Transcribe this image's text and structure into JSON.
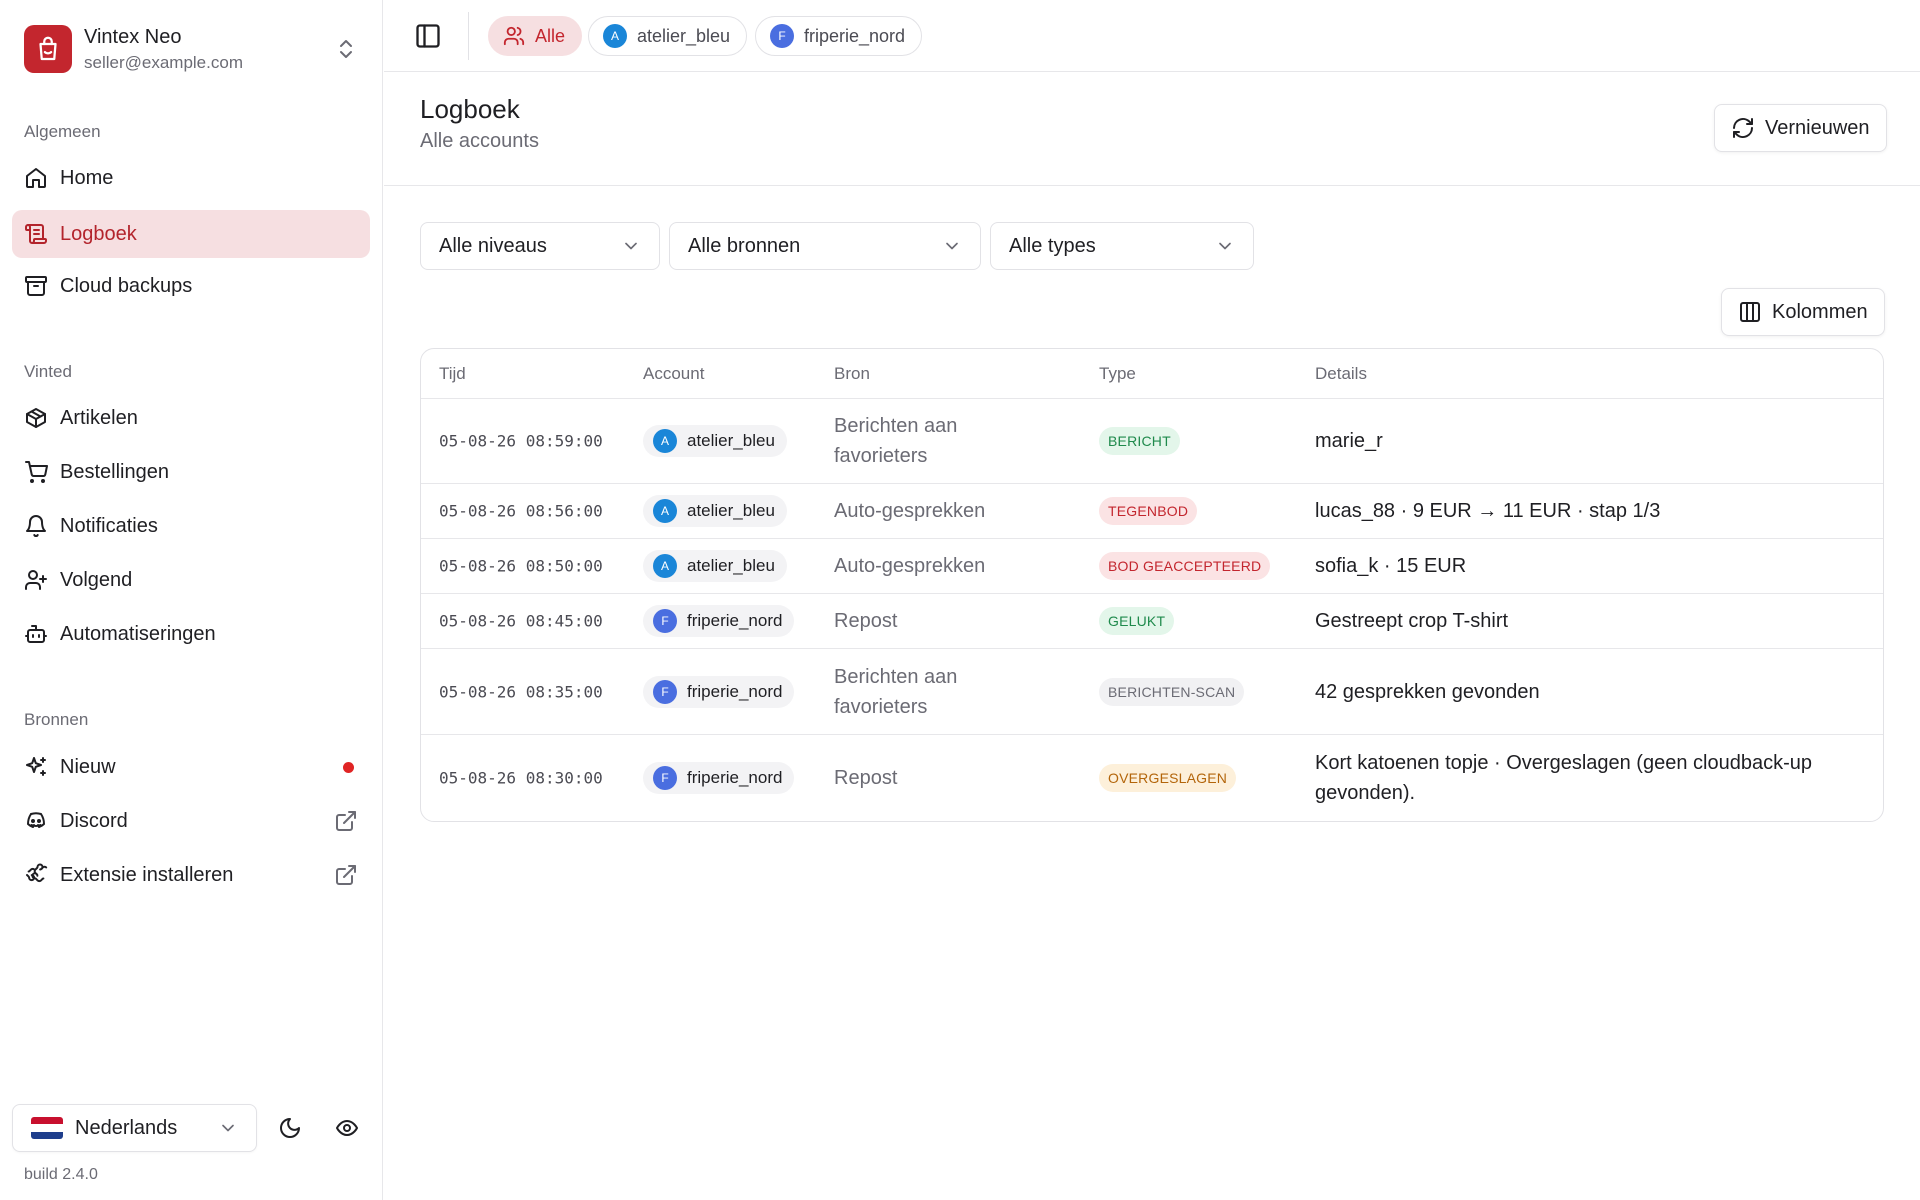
{
  "app": {
    "name": "Vintex Neo",
    "email": "seller@example.com",
    "brand_color": "#c3262e"
  },
  "sidebar": {
    "sections": {
      "general": "Algemeen",
      "vinted": "Vinted",
      "sources": "Bronnen"
    },
    "general_items": [
      {
        "label": "Home",
        "icon": "home-icon"
      },
      {
        "label": "Logboek",
        "icon": "logbook-icon",
        "active": true
      },
      {
        "label": "Cloud backups",
        "icon": "archive-icon"
      }
    ],
    "vinted_items": [
      {
        "label": "Artikelen",
        "icon": "package-icon"
      },
      {
        "label": "Bestellingen",
        "icon": "cart-icon"
      },
      {
        "label": "Notificaties",
        "icon": "bell-icon"
      },
      {
        "label": "Volgend",
        "icon": "user-plus-icon"
      },
      {
        "label": "Automatiseringen",
        "icon": "bot-icon"
      }
    ],
    "source_items": [
      {
        "label": "Nieuw",
        "icon": "sparkles-icon",
        "badge": "new-dot"
      },
      {
        "label": "Discord",
        "icon": "discord-icon",
        "trail": "external-link-icon"
      },
      {
        "label": "Extensie installeren",
        "icon": "puzzle-icon",
        "trail": "external-link-icon"
      }
    ],
    "language": "Nederlands",
    "build": "build 2.4.0"
  },
  "topbar": {
    "chips": [
      {
        "label": "Alle",
        "icon": "users-icon",
        "active": true
      },
      {
        "label": "atelier_bleu",
        "initial": "A",
        "color": "#1a86d8"
      },
      {
        "label": "friperie_nord",
        "initial": "F",
        "color": "#4a6ee0"
      }
    ]
  },
  "page": {
    "title": "Logboek",
    "subtitle": "Alle accounts",
    "refresh_label": "Vernieuwen",
    "columns_label": "Kolommen",
    "filters": {
      "levels": "Alle niveaus",
      "sources": "Alle bronnen",
      "types": "Alle types"
    }
  },
  "table": {
    "headers": {
      "time": "Tijd",
      "account": "Account",
      "source": "Bron",
      "type": "Type",
      "details": "Details"
    },
    "rows": [
      {
        "time": "05-08-26 08:59:00",
        "account": "atelier_bleu",
        "initial": "A",
        "avatar_color": "#1a86d8",
        "source": "Berichten aan favorieters",
        "type": "BERICHT",
        "type_style": "green",
        "details": "marie_r"
      },
      {
        "time": "05-08-26 08:56:00",
        "account": "atelier_bleu",
        "initial": "A",
        "avatar_color": "#1a86d8",
        "source": "Auto-gesprekken",
        "type": "TEGENBOD",
        "type_style": "red",
        "details": "lucas_88 · 9 EUR → 11 EUR · stap 1/3"
      },
      {
        "time": "05-08-26 08:50:00",
        "account": "atelier_bleu",
        "initial": "A",
        "avatar_color": "#1a86d8",
        "source": "Auto-gesprekken",
        "type": "BOD GEACCEPTEERD",
        "type_style": "red",
        "details": "sofia_k · 15 EUR"
      },
      {
        "time": "05-08-26 08:45:00",
        "account": "friperie_nord",
        "initial": "F",
        "avatar_color": "#4a6ee0",
        "source": "Repost",
        "type": "GELUKT",
        "type_style": "green",
        "details": "Gestreept crop T-shirt"
      },
      {
        "time": "05-08-26 08:35:00",
        "account": "friperie_nord",
        "initial": "F",
        "avatar_color": "#4a6ee0",
        "source": "Berichten aan favorieters",
        "type": "BERICHTEN-SCAN",
        "type_style": "gray",
        "details": "42 gesprekken gevonden"
      },
      {
        "time": "05-08-26 08:30:00",
        "account": "friperie_nord",
        "initial": "F",
        "avatar_color": "#4a6ee0",
        "source": "Repost",
        "type": "OVERGESLAGEN",
        "type_style": "amber",
        "details": "Kort katoenen topje · Overgeslagen (geen cloudback-up gevonden)."
      }
    ]
  }
}
